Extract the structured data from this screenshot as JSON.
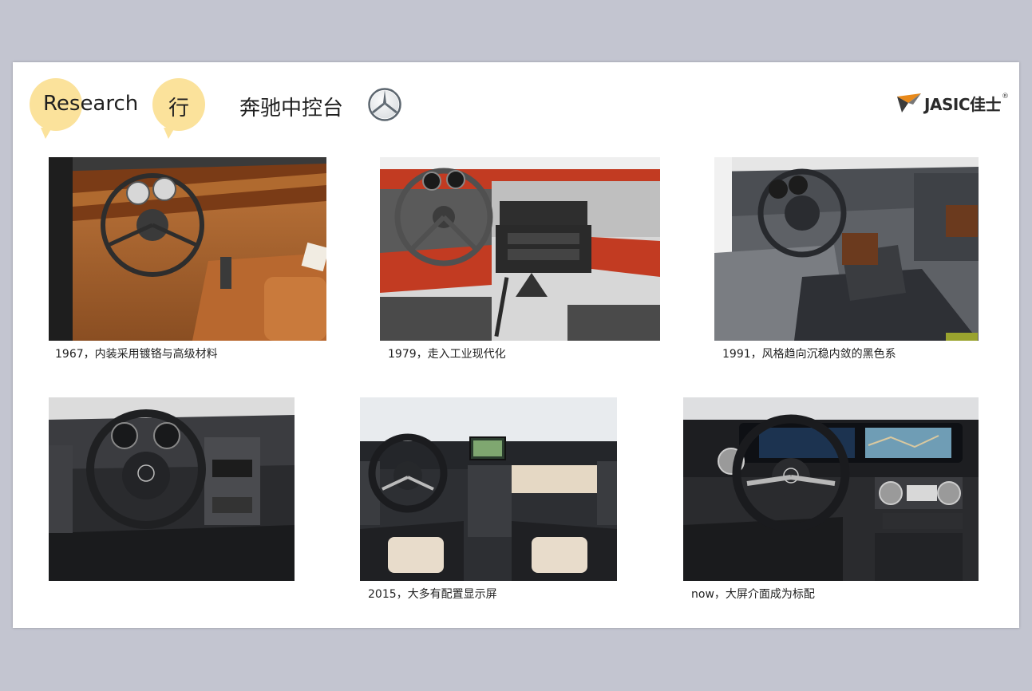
{
  "header": {
    "tag_research": "Research",
    "tag_xing": "行",
    "title": "奔驰中控台",
    "brand_logo_icon": "mercedes-star-icon"
  },
  "brand": {
    "name": "JASIC佳士",
    "registered_mark": "®",
    "accent_color": "#e8891a"
  },
  "gallery": [
    {
      "caption": "1967，内装采用镀铬与高级材料",
      "image": "1967-interior-photo"
    },
    {
      "caption": "1979，走入工业现代化",
      "image": "1979-interior-photo"
    },
    {
      "caption": "1991，风格趋向沉稳内敛的黑色系",
      "image": "1991-interior-photo"
    },
    {
      "caption": "",
      "image": "2000s-interior-photo"
    },
    {
      "caption": "2015，大多有配置显示屏",
      "image": "2015-interior-photo"
    },
    {
      "caption": "now，大屏介面成为标配",
      "image": "now-interior-photo"
    }
  ]
}
